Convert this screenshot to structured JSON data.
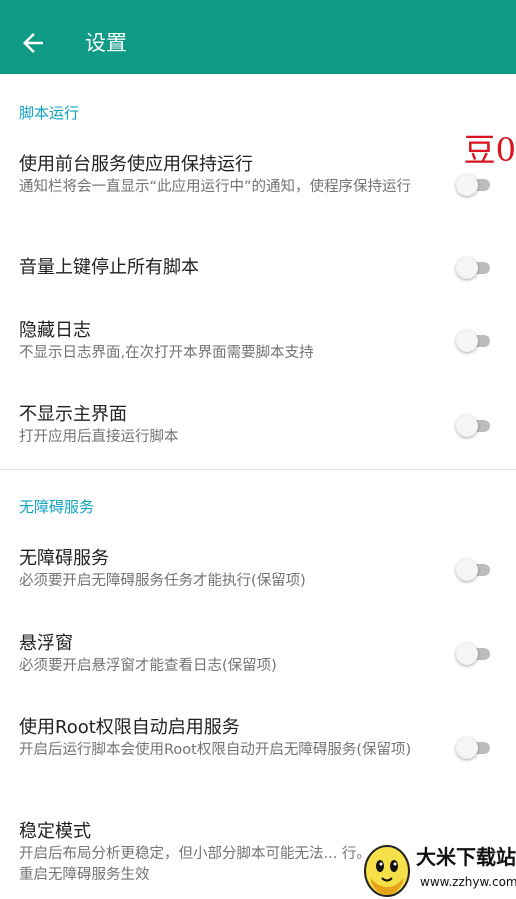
{
  "colors": {
    "primary": "#0f9a86",
    "accent": "#10a3c0",
    "watermark_red": "#d9141e"
  },
  "toolbar": {
    "back_icon": "arrow-back-icon",
    "title": "设置"
  },
  "sections": [
    {
      "header": "脚本运行",
      "items": [
        {
          "label": "使用前台服务使应用保持运行",
          "summary": "通知栏将会一直显示“此应用运行中”的通知，使程序保持运行",
          "enabled": false
        },
        {
          "label": "音量上键停止所有脚本",
          "summary": "",
          "enabled": false
        },
        {
          "label": "隐藏日志",
          "summary": "不显示日志界面,在次打开本界面需要脚本支持",
          "enabled": false
        },
        {
          "label": "不显示主界面",
          "summary": "打开应用后直接运行脚本",
          "enabled": false
        }
      ]
    },
    {
      "header": "无障碍服务",
      "items": [
        {
          "label": "无障碍服务",
          "summary": "必须要开启无障碍服务任务才能执行(保留项)",
          "enabled": false
        },
        {
          "label": "悬浮窗",
          "summary": "必须要开启悬浮窗才能查看日志(保留项)",
          "enabled": false
        },
        {
          "label": "使用Root权限自动启用服务",
          "summary": "开启后运行脚本会使用Root权限自动开启无障碍服务(保留项)",
          "enabled": false
        },
        {
          "label": "稳定模式",
          "summary": "开启后布局分析更稳定，但小部分脚本可能无法... 行。 重启无障碍服务生效",
          "enabled": false
        }
      ]
    }
  ],
  "watermarks": {
    "top": "豆0",
    "brand": "大米下载站",
    "url": "www.zzhyw.com"
  }
}
